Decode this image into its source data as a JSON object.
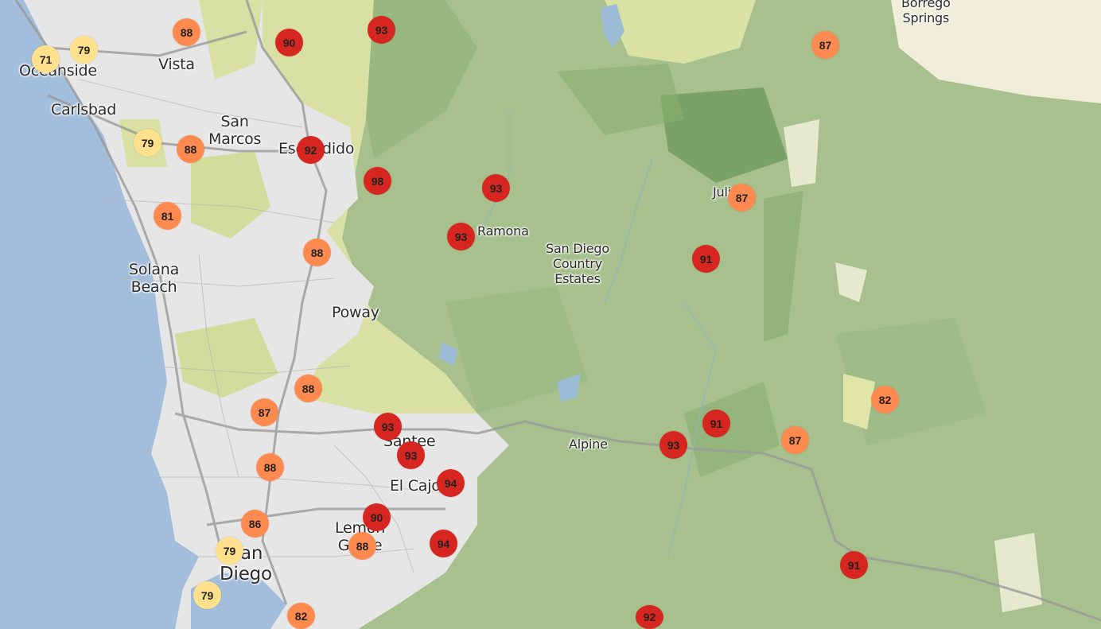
{
  "map": {
    "region": "San Diego County",
    "colors": {
      "ocean": "#a3bddc",
      "urban": "#e8e8e8",
      "terrain": "#a6bf8c",
      "dark_terrain": "#7fa56a",
      "yellowish": "#dfe6a8",
      "road": "#9a9a9a",
      "level_low": "#ffe08c",
      "level_mid": "#ff8a50",
      "level_high": "#d7261f"
    },
    "places": {
      "oceanside": "Oceanside",
      "vista": "Vista",
      "carlsbad": "Carlsbad",
      "san_marcos": "San\nMarcos",
      "escondido": "Escondido",
      "solana_beach": "Solana\nBeach",
      "poway": "Poway",
      "ramona": "Ramona",
      "sd_country_estates": "San Diego\nCountry\nEstates",
      "julian": "Julian",
      "borrego_springs": "Borrego\nSprings",
      "santee": "Santee",
      "el_cajon": "El Cajon",
      "alpine": "Alpine",
      "lemon_grove": "Lemon\nGrove",
      "san_diego": "San\nDiego"
    },
    "markers": [
      {
        "label": "71",
        "level": "low"
      },
      {
        "label": "79",
        "level": "low"
      },
      {
        "label": "88",
        "level": "mid"
      },
      {
        "label": "90",
        "level": "high"
      },
      {
        "label": "93",
        "level": "high"
      },
      {
        "label": "87",
        "level": "mid"
      },
      {
        "label": "79",
        "level": "low"
      },
      {
        "label": "88",
        "level": "mid"
      },
      {
        "label": "92",
        "level": "high"
      },
      {
        "label": "98",
        "level": "high"
      },
      {
        "label": "93",
        "level": "high"
      },
      {
        "label": "87",
        "level": "mid"
      },
      {
        "label": "81",
        "level": "mid"
      },
      {
        "label": "93",
        "level": "high"
      },
      {
        "label": "88",
        "level": "mid"
      },
      {
        "label": "91",
        "level": "high"
      },
      {
        "label": "88",
        "level": "mid"
      },
      {
        "label": "87",
        "level": "mid"
      },
      {
        "label": "93",
        "level": "high"
      },
      {
        "label": "82",
        "level": "mid"
      },
      {
        "label": "91",
        "level": "high"
      },
      {
        "label": "93",
        "level": "high"
      },
      {
        "label": "87",
        "level": "mid"
      },
      {
        "label": "88",
        "level": "mid"
      },
      {
        "label": "94",
        "level": "high"
      },
      {
        "label": "93",
        "level": "high"
      },
      {
        "label": "90",
        "level": "high"
      },
      {
        "label": "86",
        "level": "mid"
      },
      {
        "label": "88",
        "level": "mid"
      },
      {
        "label": "79",
        "level": "low"
      },
      {
        "label": "94",
        "level": "high"
      },
      {
        "label": "91",
        "level": "high"
      },
      {
        "label": "79",
        "level": "low"
      },
      {
        "label": "82",
        "level": "mid"
      },
      {
        "label": "92",
        "level": "high"
      }
    ]
  }
}
